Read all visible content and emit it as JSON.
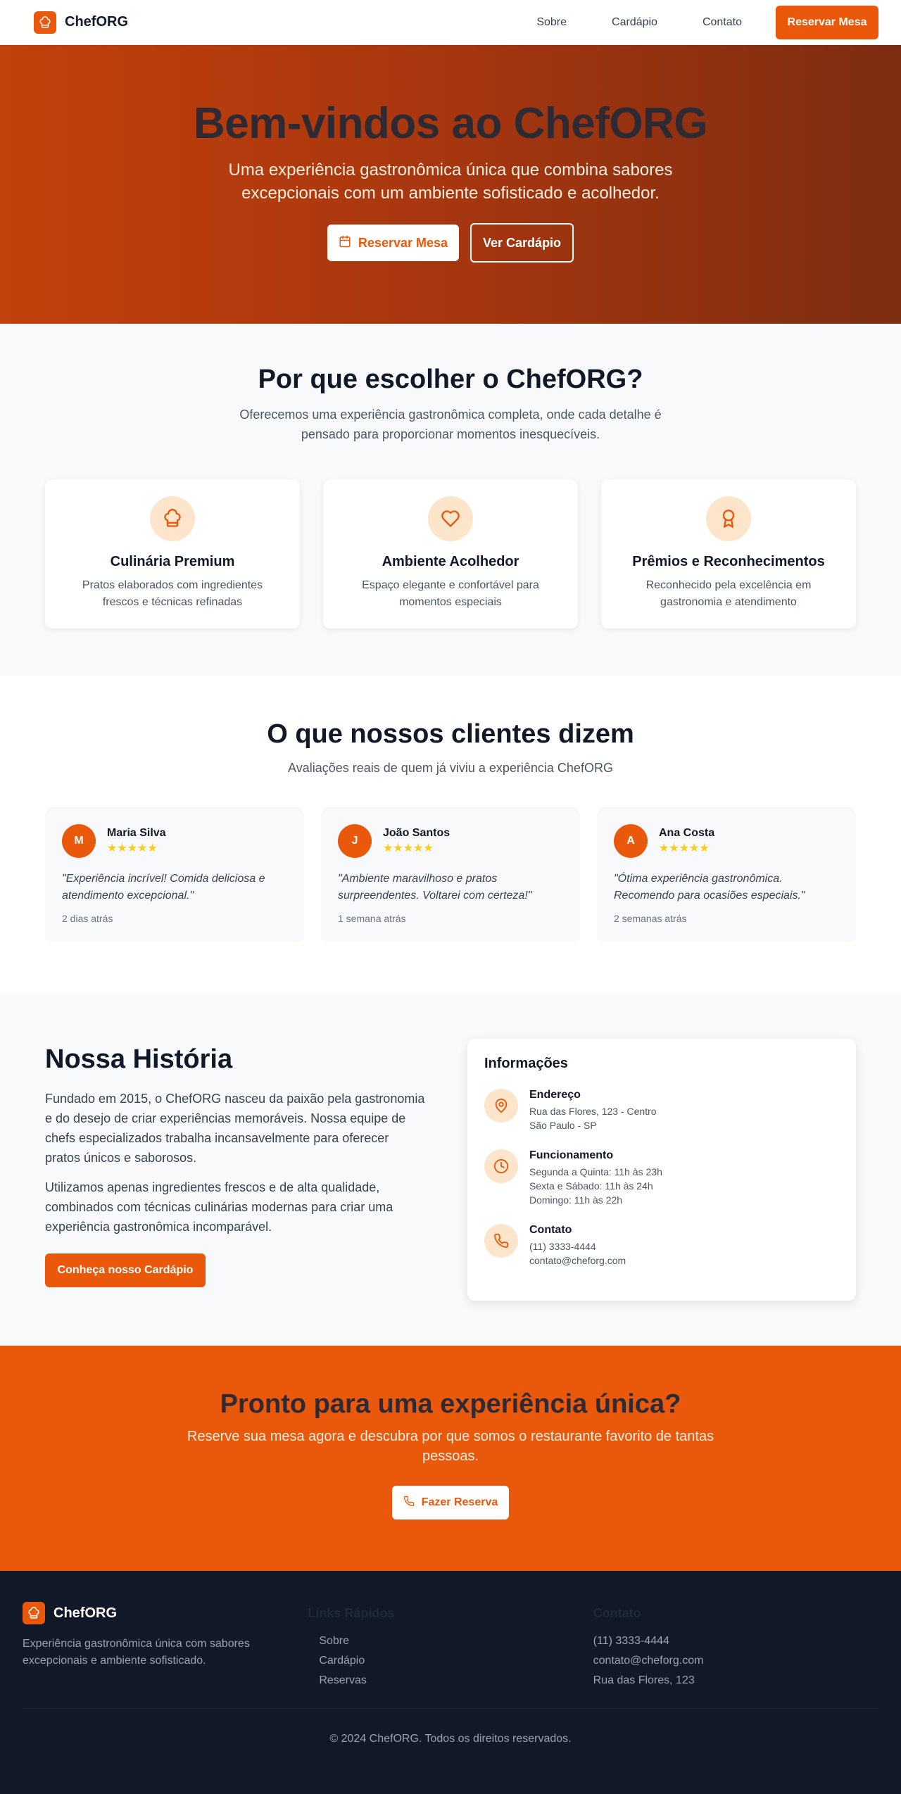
{
  "brand": {
    "name": "ChefORG",
    "icon": "chef-hat-icon",
    "accent": "#ea580c"
  },
  "nav": {
    "links": [
      "Sobre",
      "Cardápio",
      "Contato"
    ],
    "cta": "Reservar Mesa"
  },
  "hero": {
    "title": "Bem-vindos ao ChefORG",
    "subtitle": "Uma experiência gastronômica única que combina sabores excepcionais com um ambiente sofisticado e acolhedor.",
    "primary_button": "Reservar Mesa",
    "primary_icon": "calendar-icon",
    "secondary_button": "Ver Cardápio"
  },
  "why": {
    "title": "Por que escolher o ChefORG?",
    "subtitle": "Oferecemos uma experiência gastronômica completa, onde cada detalhe é pensado para proporcionar momentos inesquecíveis.",
    "features": [
      {
        "icon": "chef-hat-icon",
        "title": "Culinária Premium",
        "text": "Pratos elaborados com ingredientes frescos e técnicas refinadas"
      },
      {
        "icon": "heart-icon",
        "title": "Ambiente Acolhedor",
        "text": "Espaço elegante e confortável para momentos especiais"
      },
      {
        "icon": "award-icon",
        "title": "Prêmios e Reconhecimentos",
        "text": "Reconhecido pela excelência em gastronomia e atendimento"
      }
    ]
  },
  "testimonials": {
    "title": "O que nossos clientes dizem",
    "subtitle": "Avaliações reais de quem já viviu a experiência ChefORG",
    "items": [
      {
        "initial": "M",
        "name": "Maria Silva",
        "stars": "★★★★★",
        "rating": 5,
        "quote": "\"Experiência incrível! Comida deliciosa e atendimento excepcional.\"",
        "time": "2 dias atrás"
      },
      {
        "initial": "J",
        "name": "João Santos",
        "stars": "★★★★★",
        "rating": 5,
        "quote": "\"Ambiente maravilhoso e pratos surpreendentes. Voltarei com certeza!\"",
        "time": "1 semana atrás"
      },
      {
        "initial": "A",
        "name": "Ana Costa",
        "stars": "★★★★★",
        "rating": 5,
        "quote": "\"Ótima experiência gastronômica. Recomendo para ocasiões especiais.\"",
        "time": "2 semanas atrás"
      }
    ]
  },
  "story": {
    "title": "Nossa História",
    "p1": "Fundado em 2015, o ChefORG nasceu da paixão pela gastronomia e do desejo de criar experiências memoráveis. Nossa equipe de chefs especializados trabalha incansavelmente para oferecer pratos únicos e saborosos.",
    "p2": "Utilizamos apenas ingredientes frescos e de alta qualidade, combinados com técnicas culinárias modernas para criar uma experiência gastronômica incomparável.",
    "button": "Conheça nosso Cardápio"
  },
  "info": {
    "title": "Informações",
    "address_label": "Endereço",
    "address_lines": [
      "Rua das Flores, 123 - Centro",
      "São Paulo - SP"
    ],
    "hours_label": "Funcionamento",
    "hours_lines": [
      "Segunda a Quinta: 11h às 23h",
      "Sexta e Sábado: 11h às 24h",
      "Domingo: 11h às 22h"
    ],
    "contact_label": "Contato",
    "contact_lines": [
      "(11) 3333-4444",
      "contato@cheforg.com"
    ]
  },
  "cta": {
    "title": "Pronto para uma experiência única?",
    "subtitle": "Reserve sua mesa agora e descubra por que somos o restaurante favorito de tantas pessoas.",
    "button": "Fazer Reserva",
    "button_icon": "phone-icon"
  },
  "footer": {
    "description": "Experiência gastronômica única com sabores excepcionais e ambiente sofisticado.",
    "links_heading": "Links Rápidos",
    "links": [
      "Sobre",
      "Cardápio",
      "Reservas"
    ],
    "contact_heading": "Contato",
    "contact": [
      "(11) 3333-4444",
      "contato@cheforg.com",
      "Rua das Flores, 123"
    ],
    "copyright": "© 2024 ChefORG. Todos os direitos reservados."
  }
}
